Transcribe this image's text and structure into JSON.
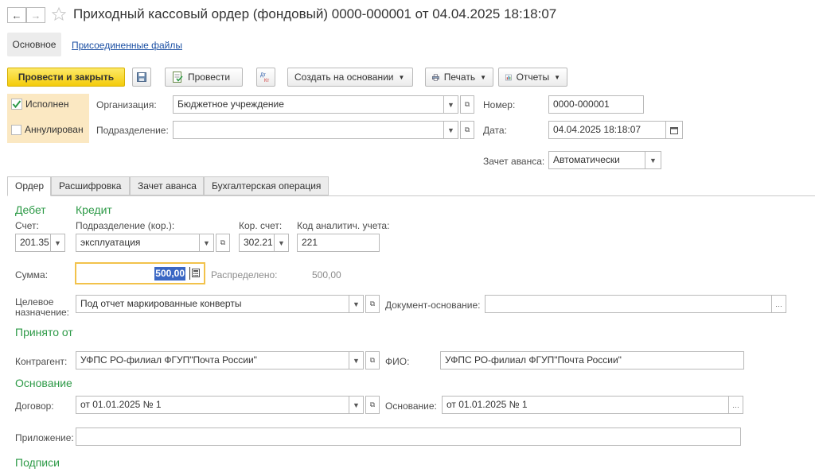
{
  "window": {
    "title": "Приходный кассовый ордер (фондовый) 0000-000001 от 04.04.2025 18:18:07"
  },
  "nav_tabs": [
    "Основное",
    "Присоединенные файлы"
  ],
  "toolbar": {
    "post_close": "Провести и закрыть",
    "post": "Провести",
    "create_based": "Создать на основании",
    "print": "Печать",
    "reports": "Отчеты"
  },
  "status": {
    "executed": "Исполнен",
    "cancelled": "Аннулирован"
  },
  "header": {
    "org_label": "Организация:",
    "org_value": "Бюджетное учреждение",
    "dept_label": "Подразделение:",
    "dept_value": "",
    "number_label": "Номер:",
    "number_value": "0000-000001",
    "date_label": "Дата:",
    "date_value": "04.04.2025 18:18:07",
    "advance_label": "Зачет аванса:",
    "advance_value": "Автоматически"
  },
  "tabs": [
    "Ордер",
    "Расшифровка",
    "Зачет аванса",
    "Бухгалтерская операция"
  ],
  "order": {
    "debit": "Дебет",
    "credit": "Кредит",
    "account_label": "Счет:",
    "account_value": "201.35",
    "corr_dept_label": "Подразделение (кор.):",
    "corr_dept_value": "эксплуатация",
    "corr_account_label": "Кор. счет:",
    "corr_account_value": "302.21",
    "analytic_label": "Код аналитич. учета:",
    "analytic_value": "221",
    "sum_label": "Сумма:",
    "sum_value": "500,00",
    "distributed_label": "Распределено:",
    "distributed_value": "500,00",
    "purpose_label_1": "Целевое",
    "purpose_label_2": "назначение:",
    "purpose_value": "Под отчет маркированные конверты",
    "basis_doc_label": "Документ-основание:",
    "basis_doc_value": "",
    "received_from": "Принято от",
    "contractor_label": "Контрагент:",
    "contractor_value": "УФПС РО-филиал ФГУП\"Почта России\"",
    "fio_label": "ФИО:",
    "fio_value": "УФПС РО-филиал ФГУП\"Почта России\"",
    "basis_section": "Основание",
    "contract_label": "Договор:",
    "contract_value": "от 01.01.2025 № 1",
    "basis_label": "Основание:",
    "basis_value": "от 01.01.2025 № 1",
    "attachment_label": "Приложение:",
    "attachment_value": "",
    "signatures": "Подписи"
  }
}
